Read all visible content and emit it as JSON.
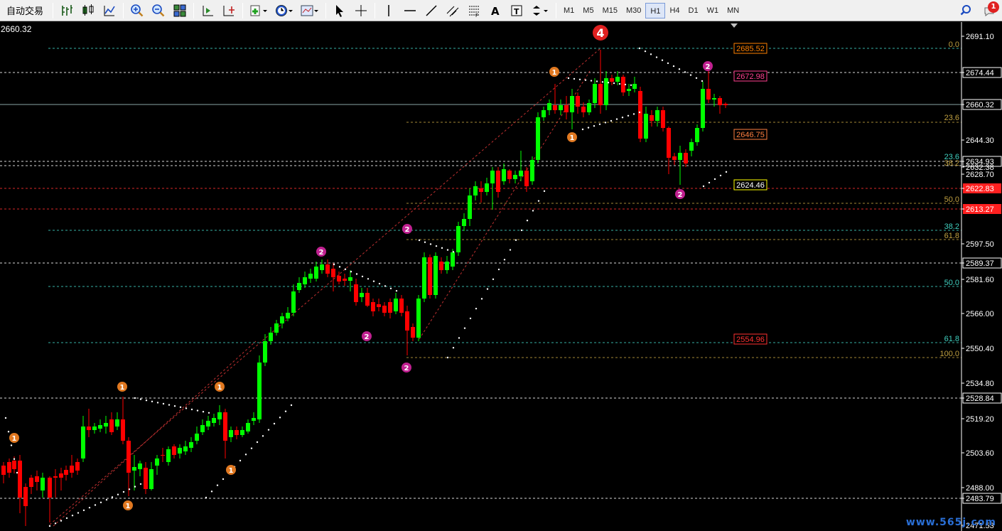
{
  "toolbar": {
    "autotrade_label": "自动交易",
    "timeframes": [
      "M1",
      "M5",
      "M15",
      "M30",
      "H1",
      "H4",
      "D1",
      "W1",
      "MN"
    ],
    "active_timeframe": "H1",
    "notification_count": "1"
  },
  "chart": {
    "current_price_label": "2660.32",
    "colors": {
      "up": "#00ff00",
      "down": "#ff0000",
      "current_line": "#a0c0c0"
    },
    "price_axis": {
      "ticks": [
        "2691.10",
        "2674.44",
        "2660.32",
        "2644.30",
        "2634.93",
        "2632.38",
        "2628.70",
        "2622.83",
        "2613.27",
        "2597.50",
        "2589.37",
        "2581.60",
        "2566.00",
        "2550.40",
        "2534.80",
        "2528.84",
        "2519.20",
        "2503.60",
        "2488.00",
        "2483.79",
        "2471.53"
      ]
    },
    "fib_labels_right": [
      "0.0",
      "23.6",
      "23.6",
      "38.2",
      "50.0",
      "38.2",
      "61.8",
      "50.0",
      "61.8",
      "100.0"
    ],
    "price_boxes": [
      "2685.52",
      "2672.98",
      "2646.75",
      "2624.46",
      "2554.96"
    ],
    "wave_markers": [
      "1",
      "1",
      "1",
      "1",
      "1",
      "2",
      "2",
      "2",
      "2",
      "1",
      "1",
      "2",
      "2",
      "4"
    ],
    "watermark": "www.565j.com"
  }
}
